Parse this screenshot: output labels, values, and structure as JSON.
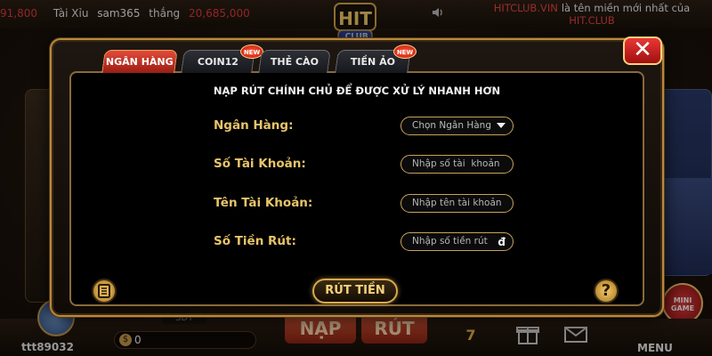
{
  "ticker": {
    "amount_left": "91,800",
    "game": "Tài Xỉu",
    "user": "sam365",
    "verb": "thắng",
    "amount": "20,685,000"
  },
  "promo": {
    "domain": "HITCLUB.VIN",
    "text": "là tên miền mới nhất của",
    "brand": "HIT.CLUB"
  },
  "logo": {
    "top": "HIT",
    "bottom": ".CLUB"
  },
  "modal": {
    "tabs": [
      {
        "label": "NGÂN HÀNG",
        "active": true,
        "new": false
      },
      {
        "label": "COIN12",
        "active": false,
        "new": true
      },
      {
        "label": "THẺ CÀO",
        "active": false,
        "new": false
      },
      {
        "label": "TIỀN ẢO",
        "active": false,
        "new": true
      }
    ],
    "new_badge": "NEW",
    "notice": "NẠP RÚT CHÍNH CHỦ ĐỂ ĐƯỢC XỬ LÝ NHANH HƠN",
    "form": {
      "bank": {
        "label": "Ngân Hàng:",
        "value": "Chọn Ngân Hàng"
      },
      "account_number": {
        "label": "Số Tài Khoản:",
        "placeholder": "Nhập số tài  khoản"
      },
      "account_name": {
        "label": "Tên Tài Khoản:",
        "placeholder": "Nhập tên tài khoản"
      },
      "amount": {
        "label": "Số Tiền Rút:",
        "placeholder": "Nhập số tiền rút",
        "currency": "đ"
      }
    },
    "submit_label": "RÚT TIỀN",
    "close_symbol": "✕",
    "help_symbol": "?"
  },
  "player": {
    "username": "ttt89032",
    "balance": "0",
    "coin_symbol": "$",
    "phone_label": "SĐT"
  },
  "bottom": {
    "deposit_label": "NẠP",
    "withdraw_label": "RÚT",
    "menu_label": "MENU",
    "minigame_label": "MINI GAME"
  },
  "colors": {
    "gold": "#e8c46a",
    "active_tab": "#e14b3a",
    "close": "#ea3636",
    "ticker_red": "#e03a3a"
  }
}
